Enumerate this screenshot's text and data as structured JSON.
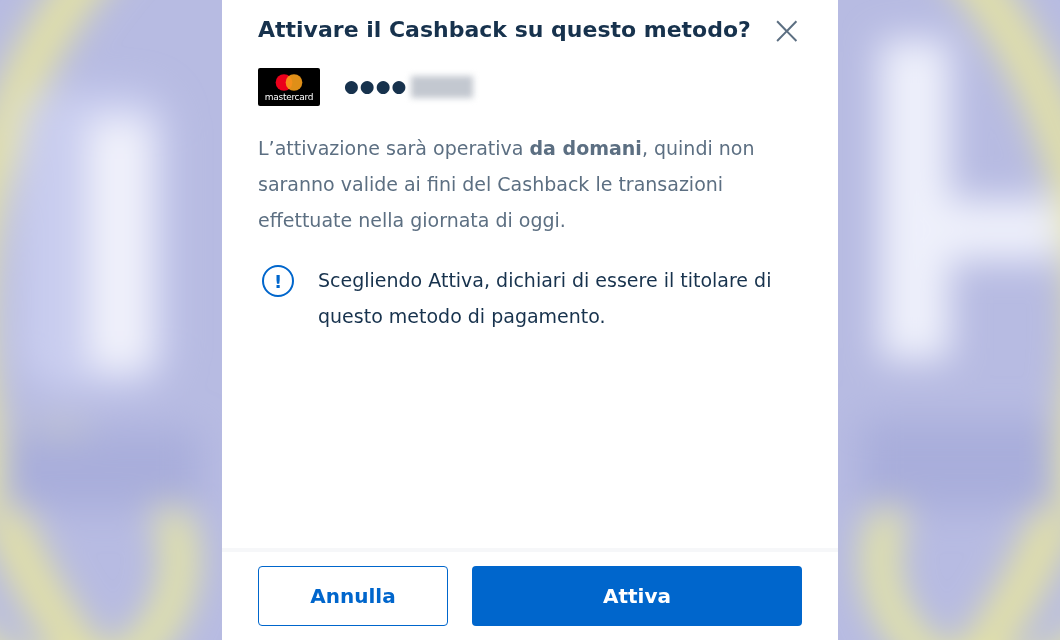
{
  "dialog": {
    "title": "Attivare il Cashback su questo metodo?",
    "close_label": "×",
    "card": {
      "brand_text": "mastercard",
      "masked_number": "●●●●"
    },
    "description": "L’attivazione sarà operativa **da domani**, quindi non saranno valide ai fini del Cashback le transazioni effettuate nella giornata di oggi.",
    "notice": {
      "icon": "!",
      "text": "Scegliendo Attiva, dichiari di essere il titolare di questo metodo di pagamento."
    },
    "buttons": [
      {
        "label": "Annulla",
        "kind": "secondary"
      },
      {
        "label": "Attiva",
        "kind": "primary"
      }
    ]
  }
}
